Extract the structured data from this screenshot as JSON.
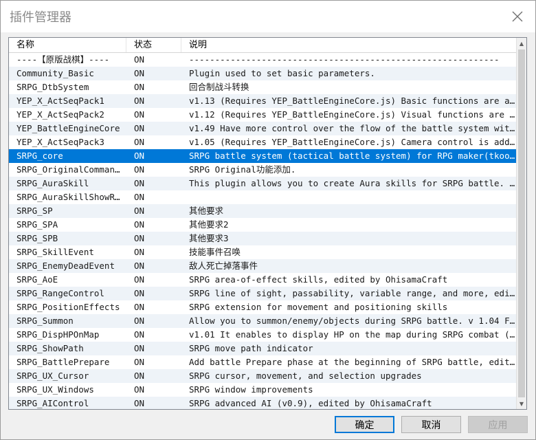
{
  "window": {
    "title": "插件管理器"
  },
  "columns": {
    "name": "名称",
    "status": "状态",
    "desc": "说明"
  },
  "rows": [
    {
      "name": "----【原版战棋】----",
      "status": "ON",
      "desc": "------------------------------------------------------------"
    },
    {
      "name": "Community_Basic",
      "status": "ON",
      "desc": "Plugin used to set basic parameters."
    },
    {
      "name": "SRPG_DtbSystem",
      "status": "ON",
      "desc": "回合制战斗转换"
    },
    {
      "name": "YEP_X_ActSeqPack1",
      "status": "ON",
      "desc": "v1.13 (Requires YEP_BattleEngineCore.js) Basic functions are added t…"
    },
    {
      "name": "YEP_X_ActSeqPack2",
      "status": "ON",
      "desc": "v1.12 (Requires YEP_BattleEngineCore.js) Visual functions are added …"
    },
    {
      "name": "YEP_BattleEngineCore",
      "status": "ON",
      "desc": "v1.49 Have more control over the flow of the battle system with this…"
    },
    {
      "name": "YEP_X_ActSeqPack3",
      "status": "ON",
      "desc": "v1.05 (Requires YEP_BattleEngineCore.js) Camera control is added to …"
    },
    {
      "name": "SRPG_core",
      "status": "ON",
      "desc": "SRPG battle system (tactical battle system) for RPG maker(tkool) MV …",
      "selected": true
    },
    {
      "name": "SRPG_OriginalCommandSp",
      "status": "ON",
      "desc": "SRPG Original功能添加."
    },
    {
      "name": "SRPG_AuraSkill",
      "status": "ON",
      "desc": "This plugin allows you to create Aura skills for SRPG battle. Place …"
    },
    {
      "name": "SRPG_AuraSkillShowRange",
      "status": "ON",
      "desc": ""
    },
    {
      "name": "SRPG_SP",
      "status": "ON",
      "desc": "其他要求"
    },
    {
      "name": "SRPG_SPA",
      "status": "ON",
      "desc": "其他要求2"
    },
    {
      "name": "SRPG_SPB",
      "status": "ON",
      "desc": "其他要求3"
    },
    {
      "name": "SRPG_SkillEvent",
      "status": "ON",
      "desc": "技能事件召唤"
    },
    {
      "name": "SRPG_EnemyDeadEvent",
      "status": "ON",
      "desc": "敌人死亡掉落事件"
    },
    {
      "name": "SRPG_AoE",
      "status": "ON",
      "desc": "SRPG area-of-effect skills, edited by OhisamaCraft"
    },
    {
      "name": "SRPG_RangeControl",
      "status": "ON",
      "desc": "SRPG line of sight, passability, variable range, and more, edited by…"
    },
    {
      "name": "SRPG_PositionEffects",
      "status": "ON",
      "desc": "SRPG extension for movement and positioning skills"
    },
    {
      "name": "SRPG_Summon",
      "status": "ON",
      "desc": "Allow you to summon/enemy/objects during SRPG battle. v 1.04 Fix a b…"
    },
    {
      "name": "SRPG_DispHPOnMap",
      "status": "ON",
      "desc": "v1.01 It enables to display HP on the map during SRPG combat (edited…"
    },
    {
      "name": "SRPG_ShowPath",
      "status": "ON",
      "desc": "SRPG move path indicator"
    },
    {
      "name": "SRPG_BattlePrepare",
      "status": "ON",
      "desc": "Add battle Prepare phase at the beginning of SRPG battle, edited by …"
    },
    {
      "name": "SRPG_UX_Cursor",
      "status": "ON",
      "desc": "SRPG cursor, movement, and selection upgrades"
    },
    {
      "name": "SRPG_UX_Windows",
      "status": "ON",
      "desc": "SRPG window improvements"
    },
    {
      "name": "SRPG_AIControl",
      "status": "ON",
      "desc": "SRPG advanced AI (v0.9), edited by OhisamaCraft"
    }
  ],
  "buttons": {
    "ok": "确定",
    "cancel": "取消",
    "apply": "应用"
  },
  "colors": {
    "selection": "#0078d7",
    "alt_row": "#eef3f8"
  },
  "icons": {
    "close": "close-icon",
    "scroll_up": "chevron-up-icon",
    "scroll_down": "chevron-down-icon"
  }
}
